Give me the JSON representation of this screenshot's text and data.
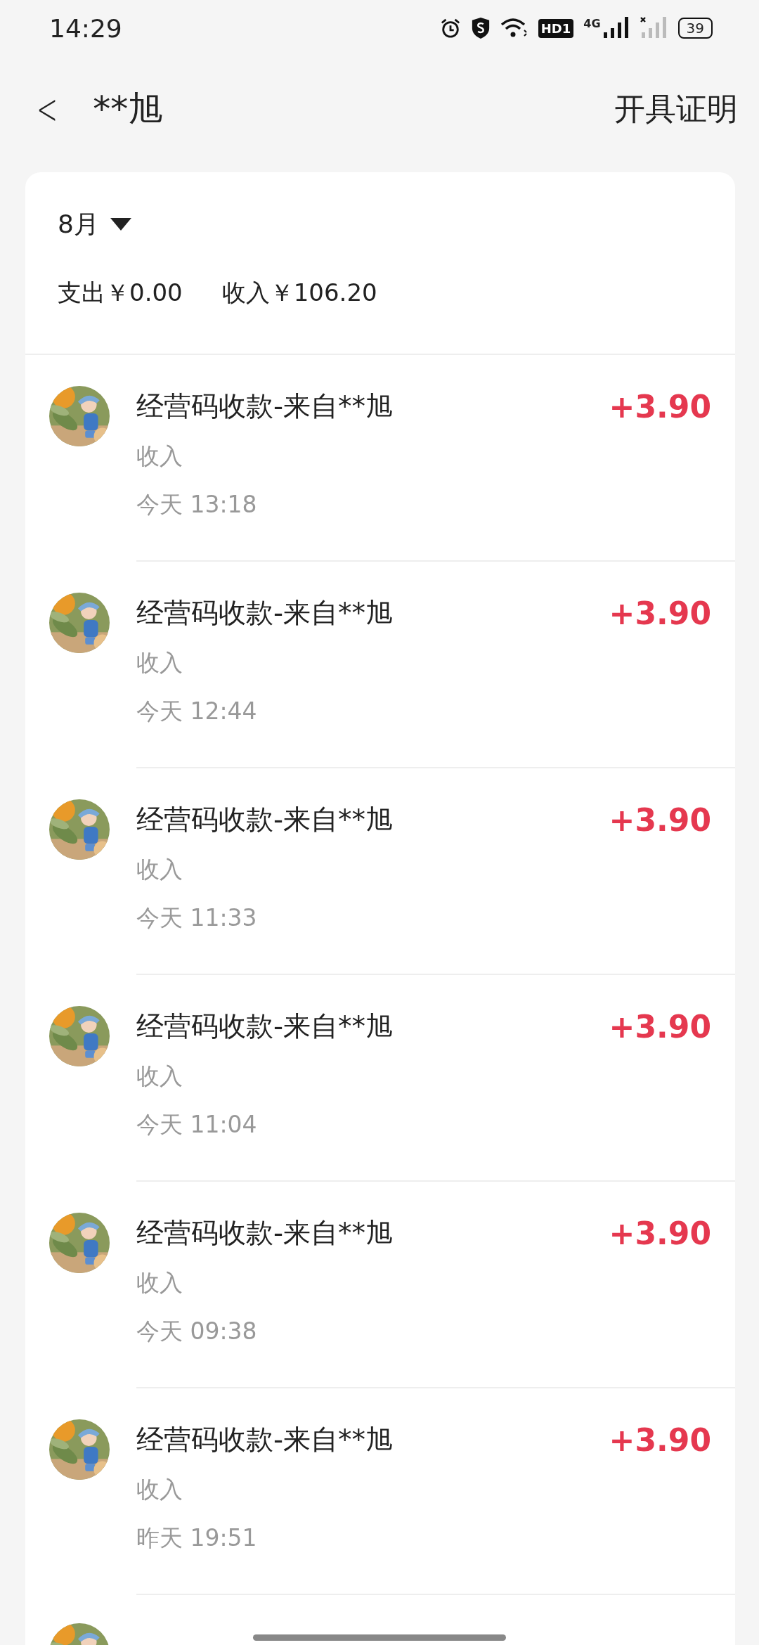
{
  "status_bar": {
    "time": "14:29",
    "hd_badge": "HD1",
    "network": "4G",
    "battery": "39"
  },
  "header": {
    "back": "<",
    "title": "**旭",
    "action": "开具证明"
  },
  "month": {
    "label": "8月"
  },
  "summary": {
    "expense": "支出￥0.00",
    "income": "收入￥106.20"
  },
  "rows": [
    {
      "title": "经营码收款-来自**旭",
      "type": "收入",
      "time": "今天 13:18",
      "amount": "+3.90"
    },
    {
      "title": "经营码收款-来自**旭",
      "type": "收入",
      "time": "今天 12:44",
      "amount": "+3.90"
    },
    {
      "title": "经营码收款-来自**旭",
      "type": "收入",
      "time": "今天 11:33",
      "amount": "+3.90"
    },
    {
      "title": "经营码收款-来自**旭",
      "type": "收入",
      "time": "今天 11:04",
      "amount": "+3.90"
    },
    {
      "title": "经营码收款-来自**旭",
      "type": "收入",
      "time": "今天 09:38",
      "amount": "+3.90"
    },
    {
      "title": "经营码收款-来自**旭",
      "type": "收入",
      "time": "昨天 19:51",
      "amount": "+3.90"
    }
  ]
}
